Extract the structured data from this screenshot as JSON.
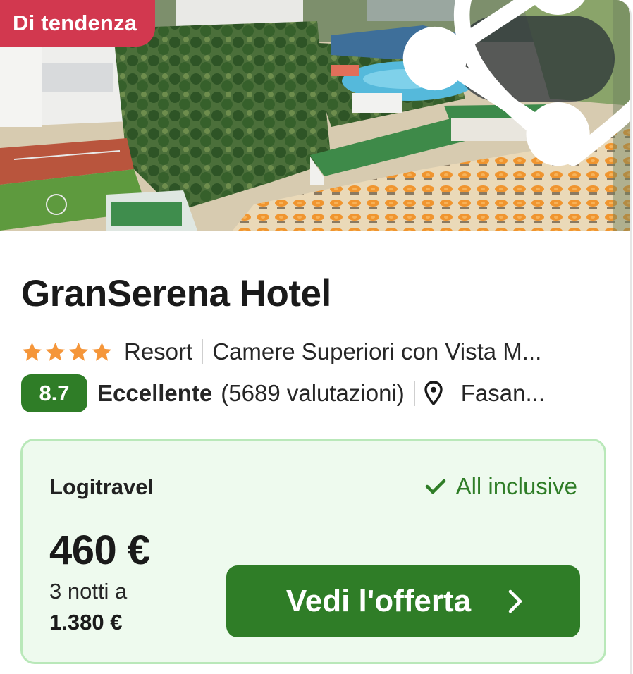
{
  "hero": {
    "badge": "Di tendenza",
    "share_icon": "share-icon",
    "favorite_icon": "heart-icon"
  },
  "hotel": {
    "name": "GranSerena Hotel",
    "stars": 4,
    "category": "Resort",
    "room_type": "Camere Superiori con Vista M...",
    "score": "8.7",
    "rating_word": "Eccellente",
    "review_count": "(5689 valutazioni)",
    "location": "Fasan..."
  },
  "offer": {
    "provider": "Logitravel",
    "board": "All inclusive",
    "price": "460 €",
    "nights": "3 notti a",
    "total": "1.380 €",
    "cta_label": "Vedi l'offerta"
  },
  "colors": {
    "badge": "#d2384f",
    "brand_green": "#2f7d27",
    "star": "#f5963a",
    "offer_bg": "#eefaee",
    "offer_border": "#b9e8b9"
  }
}
